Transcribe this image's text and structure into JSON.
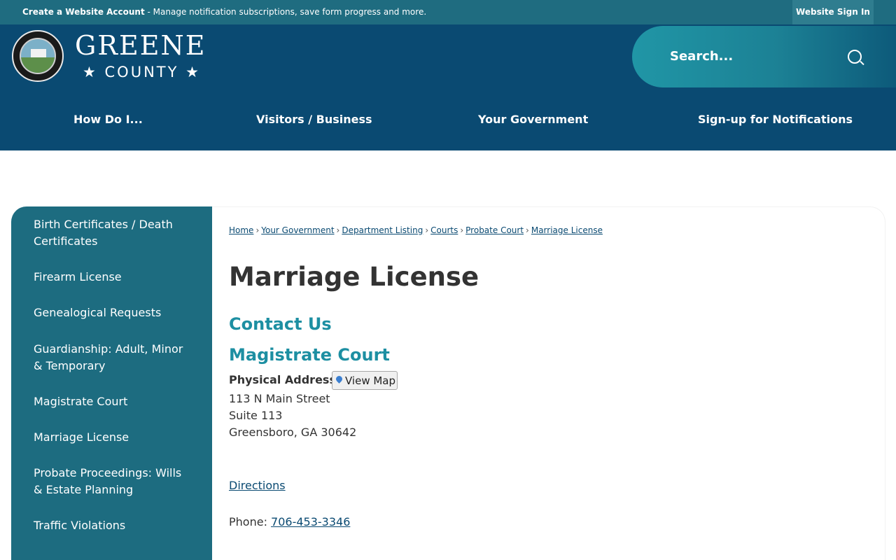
{
  "topbar": {
    "create_account": "Create a Website Account",
    "message": " - Manage notification subscriptions, save form progress and more.",
    "sign_in": "Website Sign In"
  },
  "header": {
    "brand_line1": "GREENE",
    "brand_line2": "★ COUNTY ★",
    "search_placeholder": "Search...",
    "nav": [
      "How Do I...",
      "Visitors / Business",
      "Your Government",
      "Sign-up for Notifications"
    ]
  },
  "sidebar": {
    "items": [
      "Birth Certificates / Death Certificates",
      "Firearm License",
      "Genealogical Requests",
      "Guardianship: Adult, Minor & Temporary",
      "Magistrate Court",
      "Marriage License",
      "Probate Proceedings: Wills & Estate Planning",
      "Traffic Violations"
    ]
  },
  "breadcrumb": [
    "Home",
    "Your Government",
    "Department Listing",
    "Courts",
    "Probate Court",
    "Marriage License"
  ],
  "page": {
    "title": "Marriage License",
    "contact_heading": "Contact Us",
    "office_heading": "Magistrate Court",
    "physical_address_label": "Physical Address",
    "view_map": "View Map",
    "address_line1": "113 N Main Street",
    "address_line2": "Suite 113",
    "address_line3": "Greensboro, GA 30642",
    "directions": "Directions",
    "phone_label": "Phone: ",
    "phone": "706-453-3346"
  },
  "colors": {
    "topbar": "#1f6c80",
    "header": "#0a4a72",
    "sidebar": "#1d6c80",
    "accent_heading": "#1d8fa2"
  }
}
